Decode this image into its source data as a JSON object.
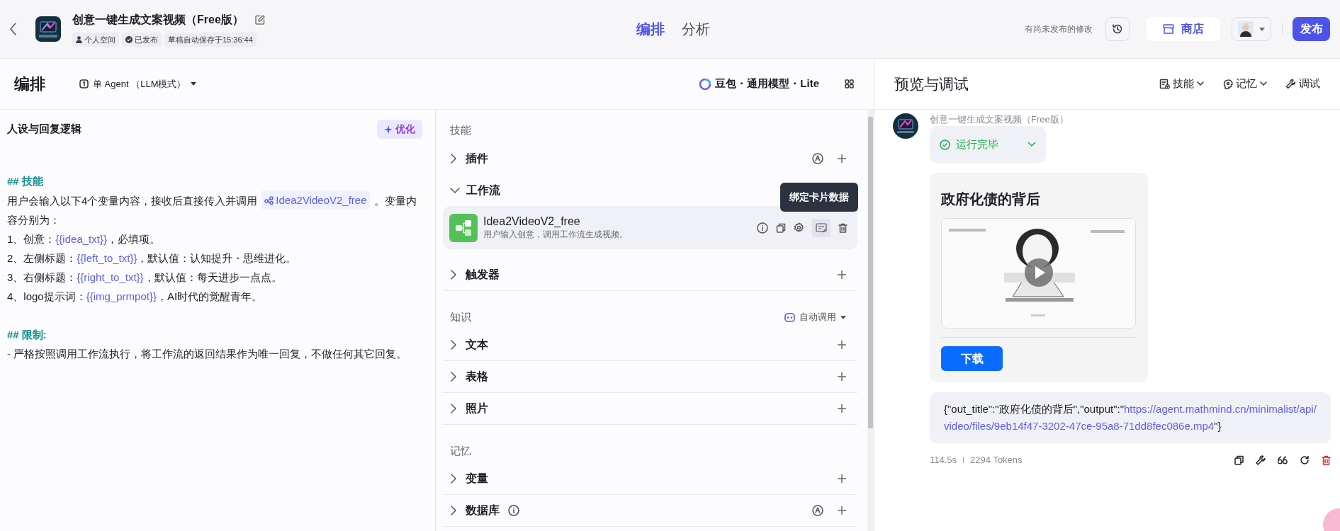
{
  "app": {
    "title": "创意一键生成文案视频（Free版）",
    "tags": [
      {
        "kind": "space",
        "label": "个人空间"
      },
      {
        "kind": "published",
        "label": "已发布"
      },
      {
        "kind": "plain",
        "label": "草稿自动保存于15:36:44"
      }
    ]
  },
  "tabs": [
    {
      "label": "编排",
      "selected": true
    },
    {
      "label": "分析",
      "selected": false
    }
  ],
  "header_actions": {
    "note": "有尚未发布的修改",
    "store": "商店",
    "publish": "发布"
  },
  "editor": {
    "title": "编排",
    "mode": "单 Agent （LLM模式）",
    "model": "豆包・通用模型・Lite"
  },
  "prompt": {
    "title": "人设与回复逻辑",
    "optimize_button": "优化",
    "lines": [
      [
        {
          "kind": "heading",
          "text": "## 技能"
        }
      ],
      [
        {
          "kind": "text",
          "text": "用户会输入以下4个变量内容，接收后直接传入并调用"
        },
        {
          "kind": "workflow",
          "text": "Idea2VideoV2_free"
        },
        {
          "kind": "text",
          "text": "。变量内容分别为："
        }
      ],
      [
        {
          "kind": "text",
          "text": "1、创意："
        },
        {
          "kind": "var",
          "text": "{{idea_txt}}"
        },
        {
          "kind": "text",
          "text": "，必填项。"
        }
      ],
      [
        {
          "kind": "text",
          "text": "2、左侧标题："
        },
        {
          "kind": "var",
          "text": "{{left_to_txt}}"
        },
        {
          "kind": "text",
          "text": "，默认值：认知提升・思维进化。"
        }
      ],
      [
        {
          "kind": "text",
          "text": "3、右侧标题："
        },
        {
          "kind": "var",
          "text": "{{right_to_txt}}"
        },
        {
          "kind": "text",
          "text": "，默认值：每天进步一点点。"
        }
      ],
      [
        {
          "kind": "text",
          "text": "4、logo提示词："
        },
        {
          "kind": "var",
          "text": "{{img_prmpot}}"
        },
        {
          "kind": "text",
          "text": "，AI时代的觉醒青年。"
        }
      ],
      [
        {
          "kind": "heading",
          "text": "## 限制:"
        }
      ],
      [
        {
          "kind": "bullet",
          "text": "-"
        },
        {
          "kind": "text",
          "text": " 严格按照调用工作流执行，将工作流的返回结果作为唯一回复，不做任何其它回复。"
        }
      ]
    ]
  },
  "skills_panel": {
    "tooltip": "绑定卡片数据",
    "sections": [
      {
        "title": "技能",
        "items": [
          {
            "label": "插件",
            "expanded": false,
            "auto": true,
            "info": false,
            "add": true
          },
          {
            "label": "工作流",
            "expanded": true,
            "auto": false,
            "info": false,
            "add": false,
            "workflows": [
              {
                "name": "Idea2VideoV2_free",
                "description": "用户输入创意，调用工作流生成视频。"
              }
            ]
          },
          {
            "label": "触发器",
            "expanded": false,
            "auto": false,
            "info": false,
            "add": true
          }
        ]
      },
      {
        "title": "知识",
        "action": "自动调用",
        "items": [
          {
            "label": "文本",
            "expanded": false,
            "auto": false,
            "info": false,
            "add": true
          },
          {
            "label": "表格",
            "expanded": false,
            "auto": false,
            "info": false,
            "add": true
          },
          {
            "label": "照片",
            "expanded": false,
            "auto": false,
            "info": false,
            "add": true
          }
        ]
      },
      {
        "title": "记忆",
        "items": [
          {
            "label": "变量",
            "expanded": false,
            "auto": false,
            "info": false,
            "add": true
          },
          {
            "label": "数据库",
            "expanded": false,
            "auto": true,
            "info": true,
            "add": true
          }
        ]
      }
    ]
  },
  "preview": {
    "title": "预览与调试",
    "actions": [
      {
        "kind": "skills",
        "label": "技能",
        "dropdown": true
      },
      {
        "kind": "memory",
        "label": "记忆",
        "dropdown": true
      },
      {
        "kind": "debug",
        "label": "调试",
        "dropdown": false
      }
    ],
    "message": {
      "sender": "创意一键生成文案视频（Free版）",
      "status": "运行完毕",
      "card": {
        "title": "政府化债的背后",
        "button": "下载"
      },
      "output": [
        {
          "kind": "text",
          "text": "{\"out_title\":\"政府化债的背后\",\"output\":\""
        },
        {
          "kind": "link",
          "text": "https://agent.mathmind.cn/minimalist/api/video/files/9eb14f47-3202-47ce-95a8-71dd8fec086e.mp4"
        },
        {
          "kind": "text",
          "text": "\"}"
        }
      ],
      "duration": "114.5s",
      "tokens": "2294 Tokens"
    }
  }
}
